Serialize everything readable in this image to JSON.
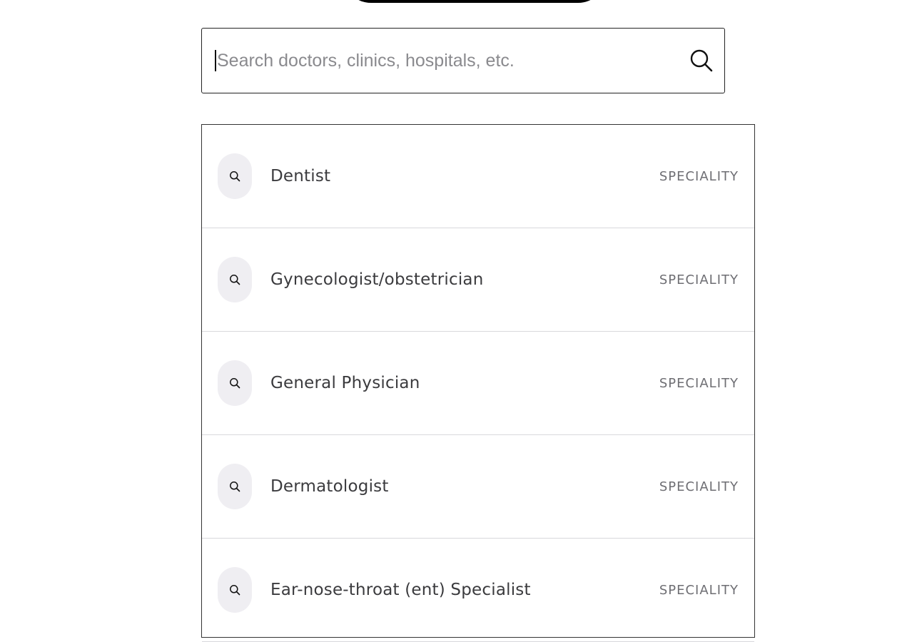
{
  "search": {
    "placeholder": "Search doctors, clinics, hospitals, etc.",
    "value": "",
    "button_icon": "search-icon"
  },
  "results": [
    {
      "label": "Dentist",
      "type": "SPECIALITY",
      "icon": "search-icon"
    },
    {
      "label": "Gynecologist/obstetrician",
      "type": "SPECIALITY",
      "icon": "search-icon"
    },
    {
      "label": "General Physician",
      "type": "SPECIALITY",
      "icon": "search-icon"
    },
    {
      "label": "Dermatologist",
      "type": "SPECIALITY",
      "icon": "search-icon"
    },
    {
      "label": "Ear-nose-throat (ent) Specialist",
      "type": "SPECIALITY",
      "icon": "search-icon"
    }
  ],
  "colors": {
    "icon_badge_bg": "#efeef2",
    "label_text": "#3b3b3e",
    "type_text": "#6e6e73",
    "placeholder_text": "#8a8a8e"
  }
}
